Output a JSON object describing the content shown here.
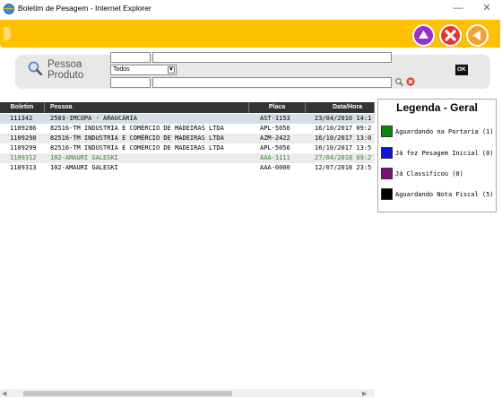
{
  "window": {
    "title": "Boletim de Pesagem - Internet Explorer",
    "minimize": "—",
    "maximize": "☐",
    "close": "✕"
  },
  "toolbar": {
    "buttons": [
      {
        "name": "up",
        "color": "#9b30c8"
      },
      {
        "name": "cancel",
        "color": "#e8352a"
      },
      {
        "name": "back",
        "color": "#f5a030"
      }
    ]
  },
  "search": {
    "label_pessoa": "Pessoa",
    "label_produto": "Produto",
    "pessoa_code": "",
    "pessoa_name": "",
    "select_value": "Todos",
    "produto_code": "",
    "produto_name": "",
    "ok_label": "OK"
  },
  "table": {
    "columns": [
      "Boletim",
      "Pessoa",
      "Placa",
      "Data/Hora"
    ],
    "rows": [
      {
        "boletim": "111342",
        "pessoa": "2503-IMCOPA - ARAUCÁRIA",
        "placa": "AST-1153",
        "data": "23/04/2010 14:1",
        "bg": "#d9dde6",
        "color": "#000"
      },
      {
        "boletim": "1109286",
        "pessoa": "82516-TM INDUSTRIA E COMÉRCIO DE MADEIRAS LTDA",
        "placa": "APL-5056",
        "data": "16/10/2017 09:2",
        "bg": "#ffffff",
        "color": "#000"
      },
      {
        "boletim": "1109298",
        "pessoa": "82516-TM INDUSTRIA E COMÉRCIO DE MADEIRAS LTDA",
        "placa": "AZM-2422",
        "data": "16/10/2017 13:0",
        "bg": "#ebebeb",
        "color": "#000"
      },
      {
        "boletim": "1109299",
        "pessoa": "82516-TM INDUSTRIA E COMÉRCIO DE MADEIRAS LTDA",
        "placa": "APL-5056",
        "data": "16/10/2017 13:5",
        "bg": "#ffffff",
        "color": "#000"
      },
      {
        "boletim": "1109312",
        "pessoa": "102-AMAURI GALESKI",
        "placa": "AAA-1111",
        "data": "27/04/2018 09:2",
        "bg": "#ebebeb",
        "color": "#2e8b2e"
      },
      {
        "boletim": "1109313",
        "pessoa": "102-AMAURI GALESKI",
        "placa": "AAA-0000",
        "data": "12/07/2018 23:5",
        "bg": "#ffffff",
        "color": "#000"
      }
    ]
  },
  "legend": {
    "title": "Legenda - Geral",
    "items": [
      {
        "label": "Aguardando na Portaria (1)",
        "color": "#0a8a0a"
      },
      {
        "label": "Já fez Pesagem Inicial (0)",
        "color": "#1010e0"
      },
      {
        "label": "Já Classificou (0)",
        "color": "#7a0f7a"
      },
      {
        "label": "Aguardando Nota Fiscal (5)",
        "color": "#000000"
      }
    ]
  }
}
